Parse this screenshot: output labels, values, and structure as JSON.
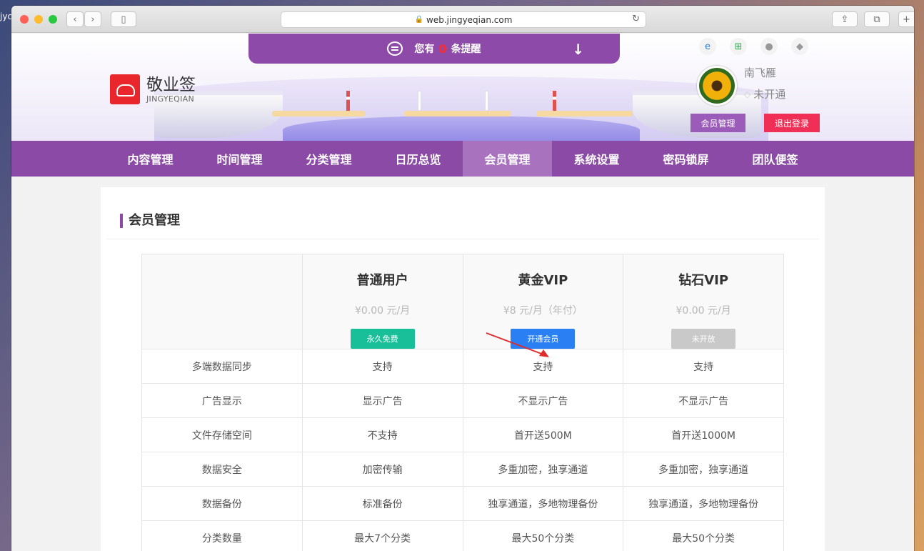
{
  "desktop": {
    "label": "jyc"
  },
  "browser": {
    "url": "web.jingyeqian.com"
  },
  "notice": {
    "prefix": "您有",
    "count": "0",
    "suffix": "条提醒"
  },
  "logo": {
    "name_cn": "敬业签",
    "name_en": "JINGYEQIAN"
  },
  "user": {
    "name": "南飞雁",
    "vip_status": "未开通",
    "member_button": "会员管理",
    "logout_button": "退出登录"
  },
  "nav": {
    "items": [
      "内容管理",
      "时间管理",
      "分类管理",
      "日历总览",
      "会员管理",
      "系统设置",
      "密码锁屏",
      "团队便签"
    ],
    "active_index": 4
  },
  "section": {
    "title": "会员管理"
  },
  "plans": [
    {
      "name": "普通用户",
      "price": "¥0.00 元/月",
      "button": "永久免费"
    },
    {
      "name": "黄金VIP",
      "price": "¥8 元/月（年付）",
      "button": "开通会员"
    },
    {
      "name": "钻石VIP",
      "price": "¥0.00 元/月",
      "button": "未开放"
    }
  ],
  "features": [
    {
      "label": "多端数据同步",
      "values": [
        "支持",
        "支持",
        "支持"
      ]
    },
    {
      "label": "广告显示",
      "values": [
        "显示广告",
        "不显示广告",
        "不显示广告"
      ]
    },
    {
      "label": "文件存储空间",
      "values": [
        "不支持",
        "首开送500M",
        "首开送1000M"
      ]
    },
    {
      "label": "数据安全",
      "values": [
        "加密传输",
        "多重加密，独享通道",
        "多重加密，独享通道"
      ]
    },
    {
      "label": "数据备份",
      "values": [
        "标准备份",
        "独享通道，多地物理备份",
        "独享通道，多地物理备份"
      ]
    },
    {
      "label": "分类数量",
      "values": [
        "最大7个分类",
        "最大50个分类",
        "最大50个分类"
      ]
    }
  ],
  "colors": {
    "brand_purple": "#8b4aa5",
    "logout_red": "#ef2f55",
    "free_green": "#18bf99",
    "vip_blue": "#2a7ff3"
  }
}
